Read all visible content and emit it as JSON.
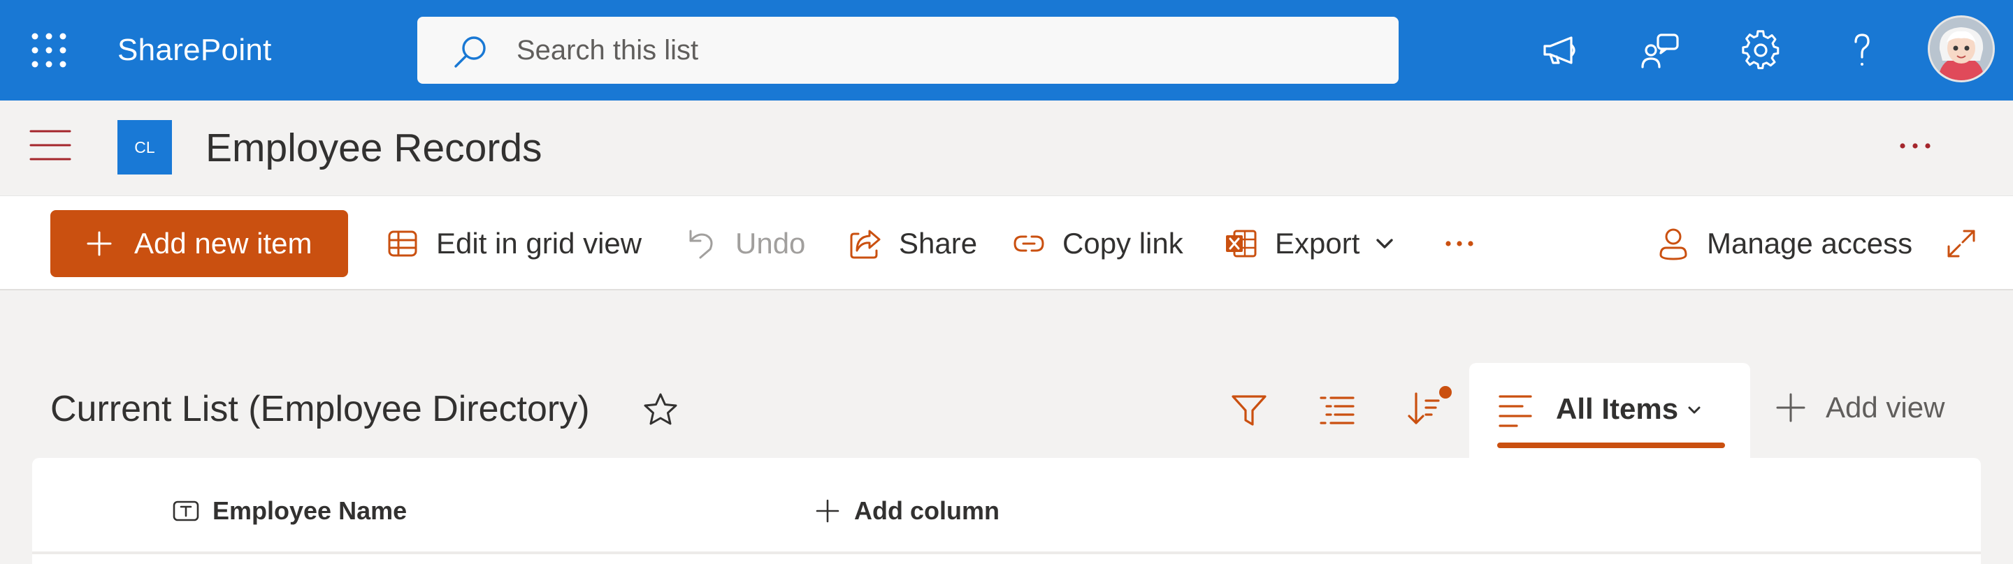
{
  "colors": {
    "suite_bar": "#1978d4",
    "accent": "#ca5010",
    "site_logo": "#1979d6",
    "page_background": "#f3f2f1"
  },
  "suite_bar": {
    "app_name": "SharePoint",
    "search_placeholder": "Search this list",
    "icons": [
      "app-launcher-icon",
      "search-icon",
      "megaphone-icon",
      "feedback-icon",
      "gear-icon",
      "help-icon",
      "avatar"
    ]
  },
  "site_header": {
    "logo_text": "CL",
    "title": "Employee Records"
  },
  "command_bar": {
    "add_new_item": "Add new item",
    "edit_in_grid_view": "Edit in grid view",
    "undo": "Undo",
    "share": "Share",
    "copy_link": "Copy link",
    "export": "Export",
    "manage_access": "Manage access"
  },
  "list": {
    "title": "Current List (Employee Directory)",
    "current_view": "All Items",
    "add_view": "Add view",
    "columns": [
      "Employee Name",
      "Add column"
    ]
  }
}
